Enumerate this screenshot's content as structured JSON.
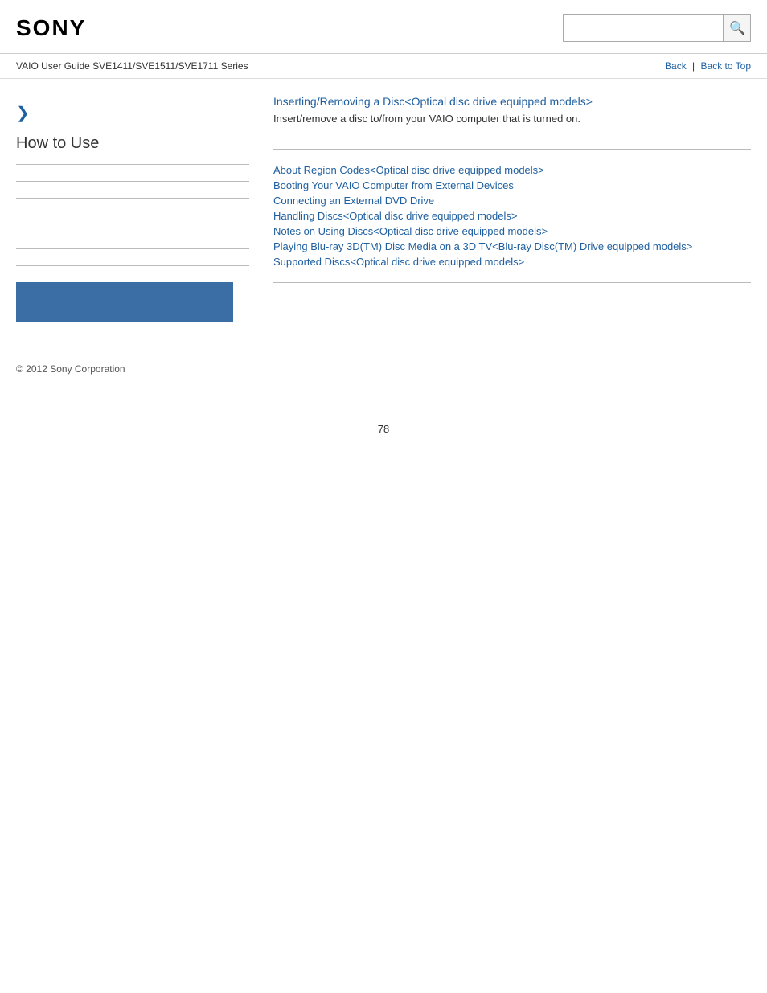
{
  "header": {
    "logo": "SONY",
    "search_placeholder": "",
    "search_icon": "🔍"
  },
  "breadcrumb": {
    "title": "VAIO User Guide SVE1411/SVE1511/SVE1711 Series",
    "back_label": "Back",
    "separator": "|",
    "back_top_label": "Back to Top"
  },
  "sidebar": {
    "arrow": "❯",
    "heading": "How to Use",
    "blue_block_color": "#3a6ea5",
    "copyright": "© 2012 Sony Corporation"
  },
  "content": {
    "main_link": "Inserting/Removing a Disc<Optical disc drive equipped models>",
    "description": "Insert/remove a disc to/from your VAIO computer that is turned on.",
    "links": [
      "About Region Codes<Optical disc drive equipped models>",
      "Booting Your VAIO Computer from External Devices",
      "Connecting an External DVD Drive",
      "Handling Discs<Optical disc drive equipped models>",
      "Notes on Using Discs<Optical disc drive equipped models>",
      "Playing Blu-ray 3D(TM) Disc Media on a 3D TV<Blu-ray Disc(TM) Drive equipped models>",
      "Supported Discs<Optical disc drive equipped models>"
    ]
  },
  "page": {
    "number": "78"
  }
}
